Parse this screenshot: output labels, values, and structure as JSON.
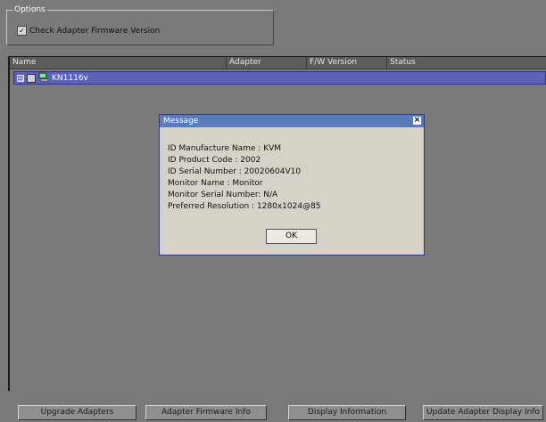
{
  "options": {
    "legend": "Options",
    "check_firmware_label": "Check Adapter Firmware Version",
    "check_firmware_checked": true
  },
  "list": {
    "columns": [
      "Name",
      "Adapter",
      "F/W Version",
      "Status"
    ],
    "rows": [
      {
        "label": "KN1116v",
        "expander": "⊟"
      }
    ]
  },
  "dialog": {
    "title": "Message",
    "close_glyph": "×",
    "lines": [
      "ID Manufacture Name : KVM",
      "ID Product Code : 2002",
      "ID Serial Number : 20020604V10",
      "Monitor Name : Monitor",
      "Monitor Serial Number: N/A",
      "Preferred Resolution : 1280x1024@85"
    ],
    "ok_label": "OK"
  },
  "buttons": {
    "upgrade": "Upgrade Adapters",
    "firmware_info": "Adapter Firmware Info",
    "display_info": "Display Information",
    "update_display": "Update Adapter Display Info"
  },
  "colors": {
    "background": "#7a7a7a",
    "selection": "#5b62b8",
    "dialog_title": "#5a7cbf",
    "dialog_body": "#d6d2c7"
  },
  "icons": {
    "tree_node": "computer-network-icon",
    "checkbox_mark": "checkmark-icon"
  }
}
